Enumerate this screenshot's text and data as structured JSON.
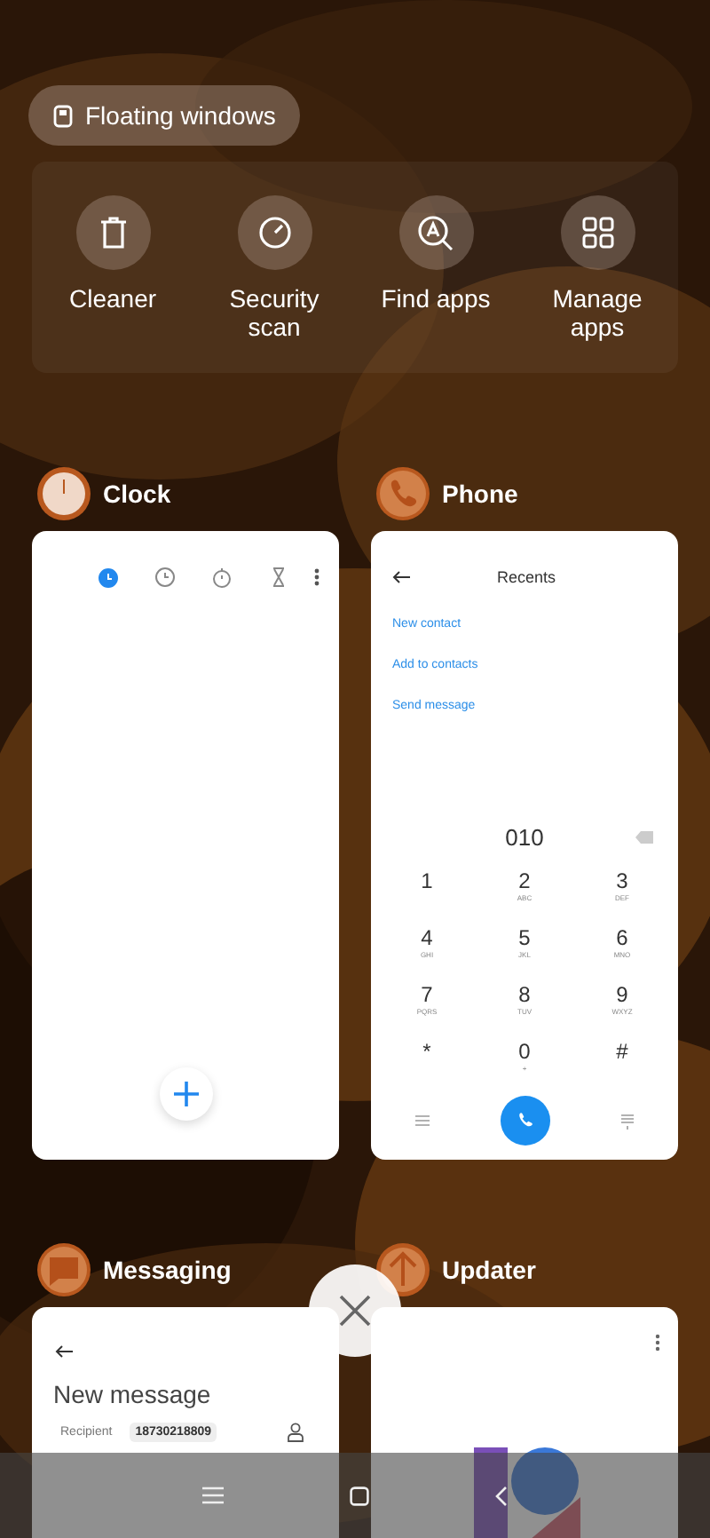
{
  "floating_windows_button": {
    "label": "Floating windows"
  },
  "quick_actions": [
    {
      "label": "Cleaner",
      "kind": "trash"
    },
    {
      "label": "Security scan",
      "kind": "gauge"
    },
    {
      "label": "Find apps",
      "kind": "find"
    },
    {
      "label": "Manage apps",
      "kind": "grid"
    }
  ],
  "apps": [
    {
      "name": "Clock",
      "kind": "clock",
      "tabs": [
        {
          "kind": "alarm",
          "selected": true
        },
        {
          "kind": "clock",
          "selected": false
        },
        {
          "kind": "stopwatch",
          "selected": false
        },
        {
          "kind": "timer",
          "selected": false
        }
      ]
    },
    {
      "name": "Phone",
      "kind": "phone",
      "title": "Recents",
      "actions": [
        "New contact",
        "Add to contacts",
        "Send message"
      ],
      "number": "010",
      "keys": [
        {
          "digit": "1"
        },
        {
          "digit": "2",
          "letters": "ABC"
        },
        {
          "digit": "3",
          "letters": "DEF"
        },
        {
          "digit": "4",
          "letters": "GHI"
        },
        {
          "digit": "5",
          "letters": "JKL"
        },
        {
          "digit": "6",
          "letters": "MNO"
        },
        {
          "digit": "7",
          "letters": "PQRS"
        },
        {
          "digit": "8",
          "letters": "TUV"
        },
        {
          "digit": "9",
          "letters": "WXYZ"
        },
        {
          "digit": "*"
        },
        {
          "digit": "0",
          "letters": "+"
        },
        {
          "digit": "#"
        }
      ]
    },
    {
      "name": "Messaging",
      "kind": "messaging",
      "title": "New message",
      "recipient_label": "Recipient",
      "recipient": "18730218809"
    },
    {
      "name": "Updater",
      "kind": "updater"
    }
  ]
}
